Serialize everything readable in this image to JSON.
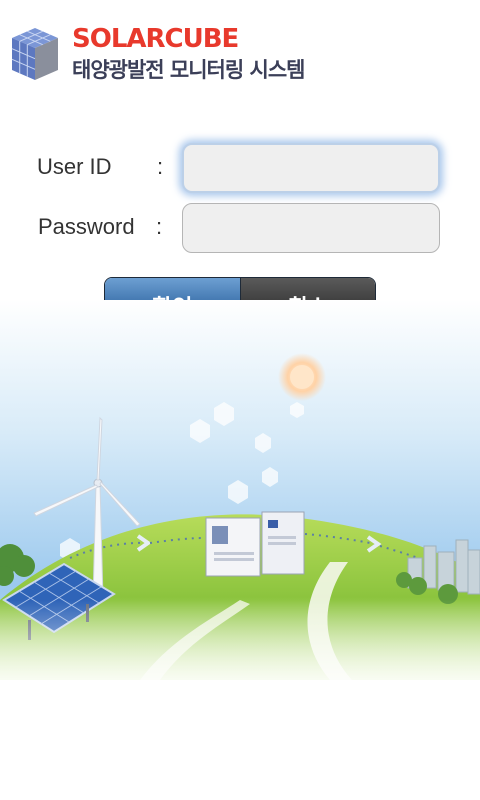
{
  "logo": {
    "brand_solar": "SOLAR",
    "brand_cube": "CUBE",
    "subtitle": "태양광발전 모니터링 시스템"
  },
  "form": {
    "userid_label": "User ID",
    "userid_colon": ":",
    "userid_value": "",
    "password_label": "Password",
    "password_colon": ":",
    "password_value": ""
  },
  "buttons": {
    "ok_label": "확인",
    "cancel_label": "취소"
  },
  "colors": {
    "brand_red": "#e8392c",
    "brand_navy": "#3b3f58",
    "ok_blue": "#3a70aa",
    "cancel_dark": "#3a3a3a"
  }
}
